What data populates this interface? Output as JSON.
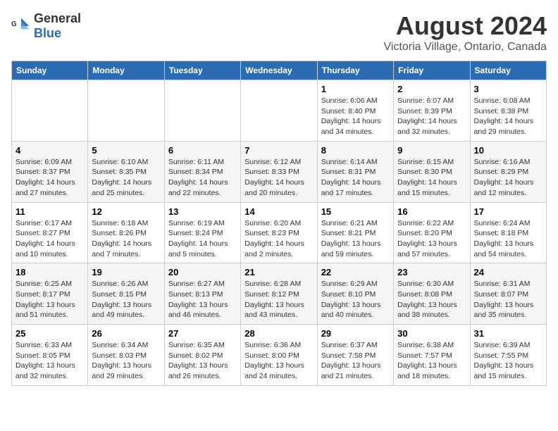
{
  "logo": {
    "general": "General",
    "blue": "Blue"
  },
  "title": "August 2024",
  "subtitle": "Victoria Village, Ontario, Canada",
  "days_of_week": [
    "Sunday",
    "Monday",
    "Tuesday",
    "Wednesday",
    "Thursday",
    "Friday",
    "Saturday"
  ],
  "weeks": [
    [
      {
        "day": "",
        "info": ""
      },
      {
        "day": "",
        "info": ""
      },
      {
        "day": "",
        "info": ""
      },
      {
        "day": "",
        "info": ""
      },
      {
        "day": "1",
        "info": "Sunrise: 6:06 AM\nSunset: 8:40 PM\nDaylight: 14 hours\nand 34 minutes."
      },
      {
        "day": "2",
        "info": "Sunrise: 6:07 AM\nSunset: 8:39 PM\nDaylight: 14 hours\nand 32 minutes."
      },
      {
        "day": "3",
        "info": "Sunrise: 6:08 AM\nSunset: 8:38 PM\nDaylight: 14 hours\nand 29 minutes."
      }
    ],
    [
      {
        "day": "4",
        "info": "Sunrise: 6:09 AM\nSunset: 8:37 PM\nDaylight: 14 hours\nand 27 minutes."
      },
      {
        "day": "5",
        "info": "Sunrise: 6:10 AM\nSunset: 8:35 PM\nDaylight: 14 hours\nand 25 minutes."
      },
      {
        "day": "6",
        "info": "Sunrise: 6:11 AM\nSunset: 8:34 PM\nDaylight: 14 hours\nand 22 minutes."
      },
      {
        "day": "7",
        "info": "Sunrise: 6:12 AM\nSunset: 8:33 PM\nDaylight: 14 hours\nand 20 minutes."
      },
      {
        "day": "8",
        "info": "Sunrise: 6:14 AM\nSunset: 8:31 PM\nDaylight: 14 hours\nand 17 minutes."
      },
      {
        "day": "9",
        "info": "Sunrise: 6:15 AM\nSunset: 8:30 PM\nDaylight: 14 hours\nand 15 minutes."
      },
      {
        "day": "10",
        "info": "Sunrise: 6:16 AM\nSunset: 8:29 PM\nDaylight: 14 hours\nand 12 minutes."
      }
    ],
    [
      {
        "day": "11",
        "info": "Sunrise: 6:17 AM\nSunset: 8:27 PM\nDaylight: 14 hours\nand 10 minutes."
      },
      {
        "day": "12",
        "info": "Sunrise: 6:18 AM\nSunset: 8:26 PM\nDaylight: 14 hours\nand 7 minutes."
      },
      {
        "day": "13",
        "info": "Sunrise: 6:19 AM\nSunset: 8:24 PM\nDaylight: 14 hours\nand 5 minutes."
      },
      {
        "day": "14",
        "info": "Sunrise: 6:20 AM\nSunset: 8:23 PM\nDaylight: 14 hours\nand 2 minutes."
      },
      {
        "day": "15",
        "info": "Sunrise: 6:21 AM\nSunset: 8:21 PM\nDaylight: 13 hours\nand 59 minutes."
      },
      {
        "day": "16",
        "info": "Sunrise: 6:22 AM\nSunset: 8:20 PM\nDaylight: 13 hours\nand 57 minutes."
      },
      {
        "day": "17",
        "info": "Sunrise: 6:24 AM\nSunset: 8:18 PM\nDaylight: 13 hours\nand 54 minutes."
      }
    ],
    [
      {
        "day": "18",
        "info": "Sunrise: 6:25 AM\nSunset: 8:17 PM\nDaylight: 13 hours\nand 51 minutes."
      },
      {
        "day": "19",
        "info": "Sunrise: 6:26 AM\nSunset: 8:15 PM\nDaylight: 13 hours\nand 49 minutes."
      },
      {
        "day": "20",
        "info": "Sunrise: 6:27 AM\nSunset: 8:13 PM\nDaylight: 13 hours\nand 46 minutes."
      },
      {
        "day": "21",
        "info": "Sunrise: 6:28 AM\nSunset: 8:12 PM\nDaylight: 13 hours\nand 43 minutes."
      },
      {
        "day": "22",
        "info": "Sunrise: 6:29 AM\nSunset: 8:10 PM\nDaylight: 13 hours\nand 40 minutes."
      },
      {
        "day": "23",
        "info": "Sunrise: 6:30 AM\nSunset: 8:08 PM\nDaylight: 13 hours\nand 38 minutes."
      },
      {
        "day": "24",
        "info": "Sunrise: 6:31 AM\nSunset: 8:07 PM\nDaylight: 13 hours\nand 35 minutes."
      }
    ],
    [
      {
        "day": "25",
        "info": "Sunrise: 6:33 AM\nSunset: 8:05 PM\nDaylight: 13 hours\nand 32 minutes."
      },
      {
        "day": "26",
        "info": "Sunrise: 6:34 AM\nSunset: 8:03 PM\nDaylight: 13 hours\nand 29 minutes."
      },
      {
        "day": "27",
        "info": "Sunrise: 6:35 AM\nSunset: 8:02 PM\nDaylight: 13 hours\nand 26 minutes."
      },
      {
        "day": "28",
        "info": "Sunrise: 6:36 AM\nSunset: 8:00 PM\nDaylight: 13 hours\nand 24 minutes."
      },
      {
        "day": "29",
        "info": "Sunrise: 6:37 AM\nSunset: 7:58 PM\nDaylight: 13 hours\nand 21 minutes."
      },
      {
        "day": "30",
        "info": "Sunrise: 6:38 AM\nSunset: 7:57 PM\nDaylight: 13 hours\nand 18 minutes."
      },
      {
        "day": "31",
        "info": "Sunrise: 6:39 AM\nSunset: 7:55 PM\nDaylight: 13 hours\nand 15 minutes."
      }
    ]
  ]
}
